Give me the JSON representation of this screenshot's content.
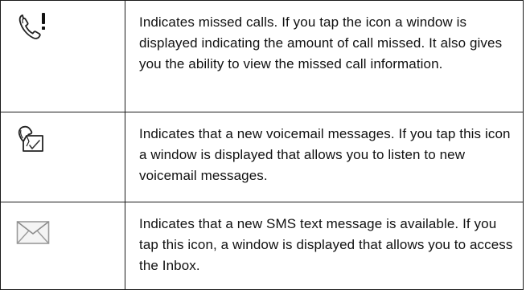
{
  "rows": [
    {
      "icon": "missed-call-icon",
      "description": "Indicates missed calls. If you tap the icon a window is displayed indicating the amount of call missed. It also gives you the ability to view the missed call information."
    },
    {
      "icon": "voicemail-icon",
      "description": "Indicates that a new voicemail messages. If you tap this icon a window is displayed that allows you to listen to new voicemail messages."
    },
    {
      "icon": "sms-message-icon",
      "description": "Indicates that a new SMS text message is available. If you tap this icon, a window is displayed that allows you to access the Inbox."
    }
  ]
}
